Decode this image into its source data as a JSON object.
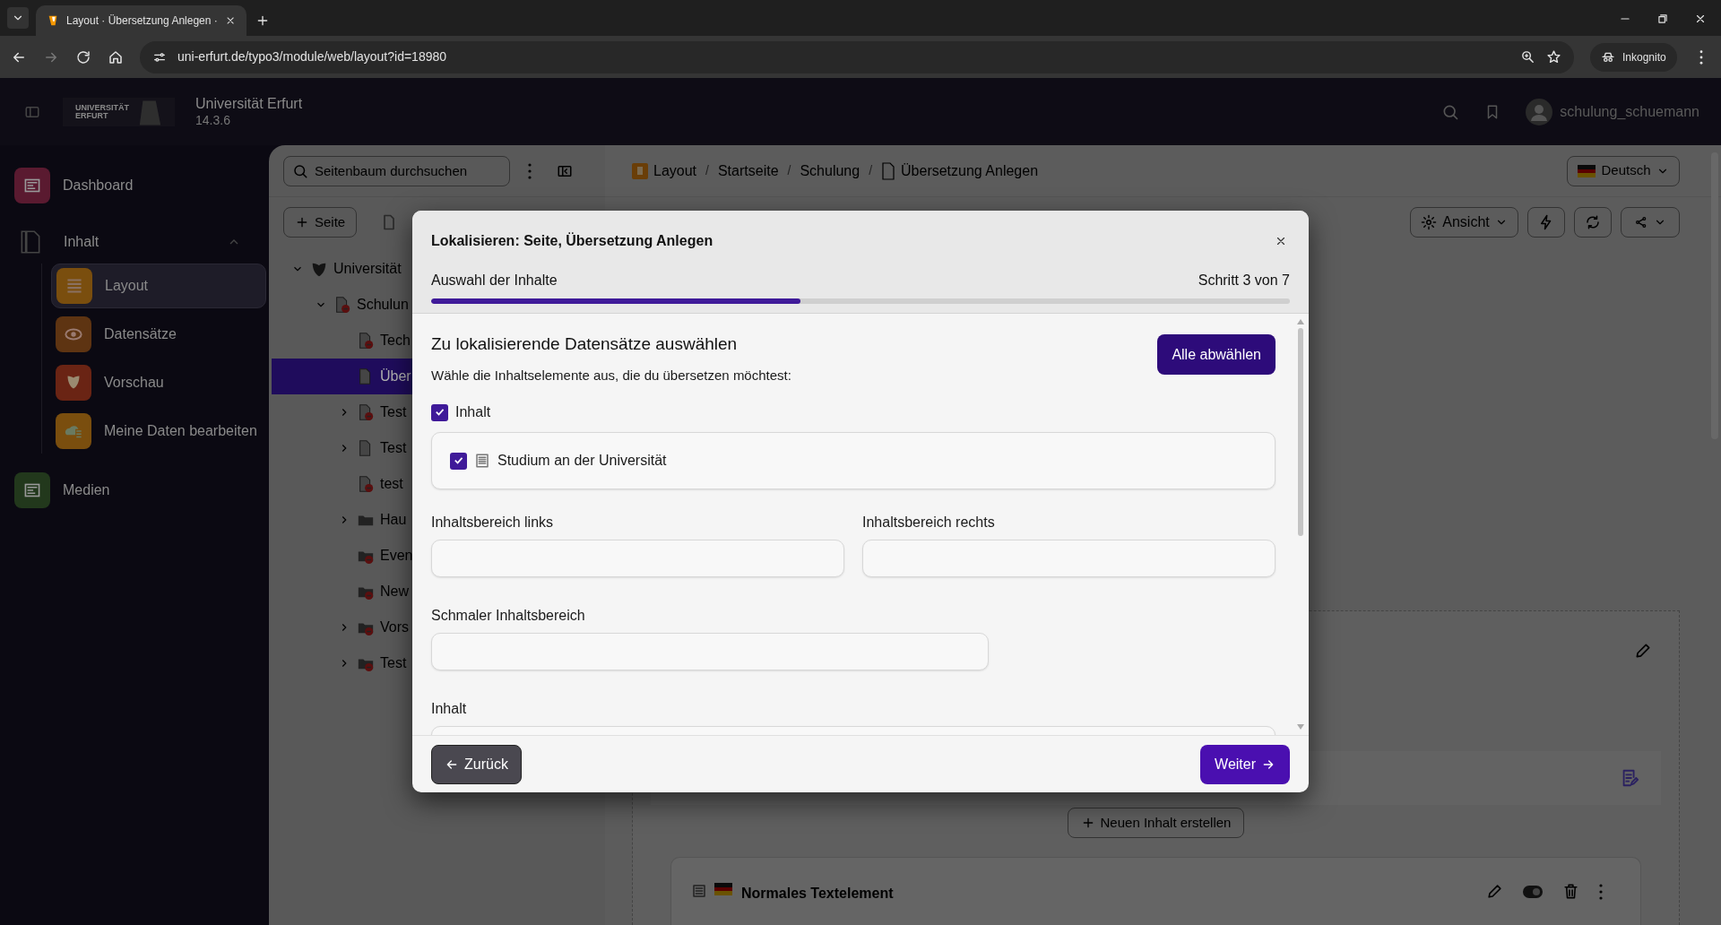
{
  "browser": {
    "tab_title": "Layout · Übersetzung Anlegen ·",
    "url": "uni-erfurt.de/typo3/module/web/layout?id=18980",
    "profile": "Inkognito"
  },
  "topbar": {
    "logo_line1": "UNIVERSITÄT",
    "logo_line2": "ERFURT",
    "site_name": "Universität Erfurt",
    "version": "14.3.6",
    "username": "schulung_schuemann"
  },
  "sidebar": {
    "items": [
      {
        "label": "Dashboard",
        "color": "#5a1a30"
      },
      {
        "label": "Inhalt",
        "expanded": true,
        "children": [
          {
            "label": "Layout",
            "color": "#7a4e0e",
            "selected": true
          },
          {
            "label": "Datensätze",
            "color": "#5e3412",
            "selected": false
          },
          {
            "label": "Vorschau",
            "color": "#6a2414",
            "selected": false
          },
          {
            "label": "Meine Daten bearbeiten",
            "color": "#7a4e0e",
            "selected": false
          }
        ]
      },
      {
        "label": "Medien",
        "color": "#22381c"
      }
    ]
  },
  "page_tree": {
    "search": {
      "placeholder": "Seitenbaum durchsuchen"
    },
    "new_page_button": "Seite",
    "nodes": [
      {
        "label": "Universität",
        "kind": "site",
        "expanded": true,
        "selected": false,
        "children": [
          {
            "label": "Schulun",
            "kind": "page_hidden",
            "expanded": true,
            "selected": false,
            "children": [
              {
                "label": "Tech",
                "kind": "page_hidden",
                "selected": false
              },
              {
                "label": "Über",
                "kind": "page",
                "selected": true
              },
              {
                "label": "Test",
                "kind": "page_hidden",
                "expanded": false,
                "selected": false
              },
              {
                "label": "Test",
                "kind": "page",
                "expanded": false,
                "selected": false
              },
              {
                "label": "test",
                "kind": "page_hidden",
                "selected": false
              },
              {
                "label": "Hau",
                "kind": "folder",
                "expanded": false,
                "selected": false
              },
              {
                "label": "Even",
                "kind": "folder_hidden",
                "selected": false
              },
              {
                "label": "New",
                "kind": "folder_hidden",
                "selected": false
              },
              {
                "label": "Vors",
                "kind": "folder_hidden",
                "expanded": false,
                "selected": false
              },
              {
                "label": "Test",
                "kind": "folder_hidden",
                "expanded": false,
                "selected": false
              }
            ]
          }
        ]
      }
    ]
  },
  "breadcrumb": [
    {
      "kind": "link",
      "label": "Layout"
    },
    {
      "kind": "separator",
      "label": "/"
    },
    {
      "kind": "link",
      "label": "Startseite"
    },
    {
      "kind": "separator",
      "label": "/"
    },
    {
      "kind": "link",
      "label": "Schulung"
    },
    {
      "kind": "separator",
      "label": "/"
    },
    {
      "kind": "link",
      "label": "Übersetzung Anlegen"
    }
  ],
  "language": "Deutsch",
  "toolbar": {
    "view_button": "Ansicht"
  },
  "content": {
    "new_content_button": "Neuen Inhalt erstellen",
    "element_title": "Normales Textelement"
  },
  "modal": {
    "title": "Lokalisieren: Seite, Übersetzung Anlegen",
    "step_label": "Auswahl der Inhalte",
    "step_count": "Schritt 3 von 7",
    "progress": {
      "level": 0.43
    },
    "heading": "Zu lokalisierende Datensätze auswählen",
    "description": "Wähle die Inhaltselemente aus, die du übersetzen möchtest:",
    "deselect_button": "Alle abwählen",
    "groups": [
      {
        "label": "Inhalt",
        "checked": true,
        "records": [
          {
            "label": "Studium an der Universität",
            "checked": true
          }
        ]
      }
    ],
    "columns": [
      {
        "label": "Inhaltsbereich links"
      },
      {
        "label": "Inhaltsbereich rechts"
      },
      {
        "label": "Schmaler Inhaltsbereich"
      },
      {
        "label": "Inhalt"
      }
    ],
    "back_button": "Zurück",
    "next_button": "Weiter"
  }
}
